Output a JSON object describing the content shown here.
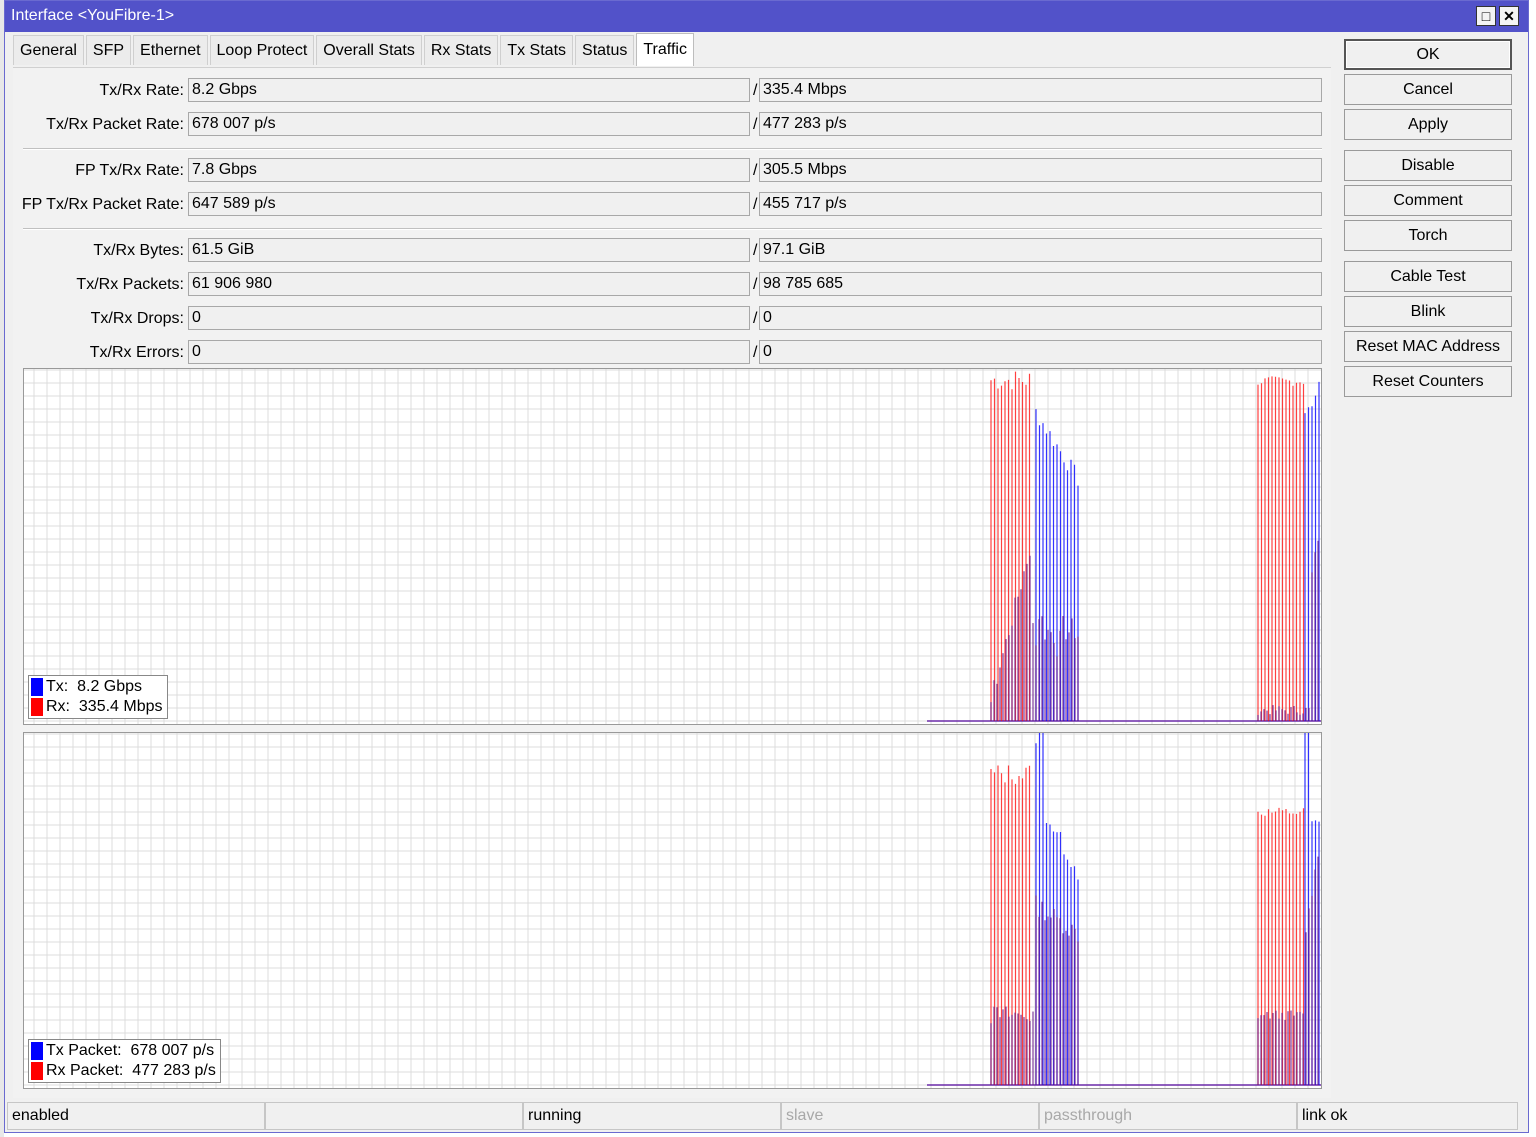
{
  "window": {
    "title": "Interface <YouFibre-1>",
    "maximize_glyph": "□",
    "close_glyph": "✕"
  },
  "tabs": [
    {
      "label": "General"
    },
    {
      "label": "SFP"
    },
    {
      "label": "Ethernet"
    },
    {
      "label": "Loop Protect"
    },
    {
      "label": "Overall Stats"
    },
    {
      "label": "Rx Stats"
    },
    {
      "label": "Tx Stats"
    },
    {
      "label": "Status"
    },
    {
      "label": "Traffic",
      "active": true
    }
  ],
  "stats": [
    {
      "label": "Tx/Rx Rate:",
      "tx": "8.2 Gbps",
      "rx": "335.4 Mbps"
    },
    {
      "label": "Tx/Rx Packet Rate:",
      "tx": "678 007 p/s",
      "rx": "477 283 p/s"
    },
    {
      "label": "FP Tx/Rx Rate:",
      "tx": "7.8 Gbps",
      "rx": "305.5 Mbps"
    },
    {
      "label": "FP Tx/Rx Packet Rate:",
      "tx": "647 589 p/s",
      "rx": "455 717 p/s"
    },
    {
      "label": "Tx/Rx Bytes:",
      "tx": "61.5 GiB",
      "rx": "97.1 GiB"
    },
    {
      "label": "Tx/Rx Packets:",
      "tx": "61 906 980",
      "rx": "98 785 685"
    },
    {
      "label": "Tx/Rx Drops:",
      "tx": "0",
      "rx": "0"
    },
    {
      "label": "Tx/Rx Errors:",
      "tx": "0",
      "rx": "0"
    }
  ],
  "slash": "/",
  "graphs": {
    "rate_legend": {
      "tx": "Tx:  8.2 Gbps",
      "rx": "Rx:  335.4 Mbps"
    },
    "packet_legend": {
      "tx": "Tx Packet:  678 007 p/s",
      "rx": "Rx Packet:  477 283 p/s"
    },
    "tx_color": "#0000ff",
    "rx_color": "#ff0000"
  },
  "buttons": [
    {
      "label": "OK"
    },
    {
      "label": "Cancel"
    },
    {
      "label": "Apply"
    },
    {
      "label": "Disable"
    },
    {
      "label": "Comment"
    },
    {
      "label": "Torch"
    },
    {
      "label": "Cable Test"
    },
    {
      "label": "Blink"
    },
    {
      "label": "Reset MAC Address"
    },
    {
      "label": "Reset Counters"
    }
  ],
  "status": [
    "enabled",
    "",
    "running",
    "slave",
    "passthrough",
    "link ok"
  ]
}
